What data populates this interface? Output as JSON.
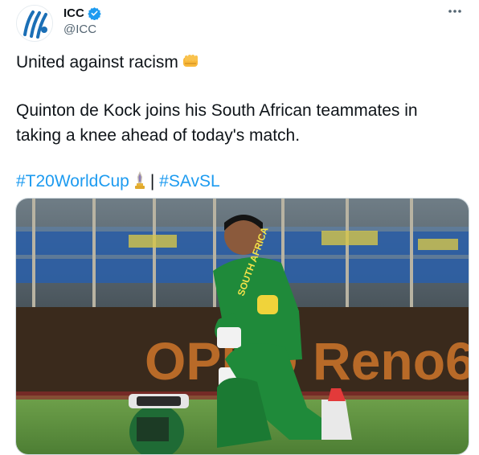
{
  "account": {
    "name": "ICC",
    "handle": "@ICC",
    "verified_icon": "verified-badge-icon",
    "avatar_icon": "icc-logo"
  },
  "menu_icon": "more-options-icon",
  "tweet": {
    "line1": "United against racism",
    "line1_emoji": "fist-emoji",
    "paragraph2": "Quinton de Kock joins his South African teammates in taking a knee ahead of today's match.",
    "hashtag1": "#T20WorldCup",
    "hashtag1_emoji": "trophy-emoji",
    "separator": "|",
    "hashtag2": "#SAvSL"
  },
  "media": {
    "jersey_text": "SOUTH AFRICA",
    "banner_text": "OPPO Reno6"
  },
  "colors": {
    "link": "#1d9bf0",
    "text": "#0f1419",
    "secondary": "#536471",
    "jersey_green": "#1f8a3a",
    "banner_dark": "#3a2a1c"
  }
}
